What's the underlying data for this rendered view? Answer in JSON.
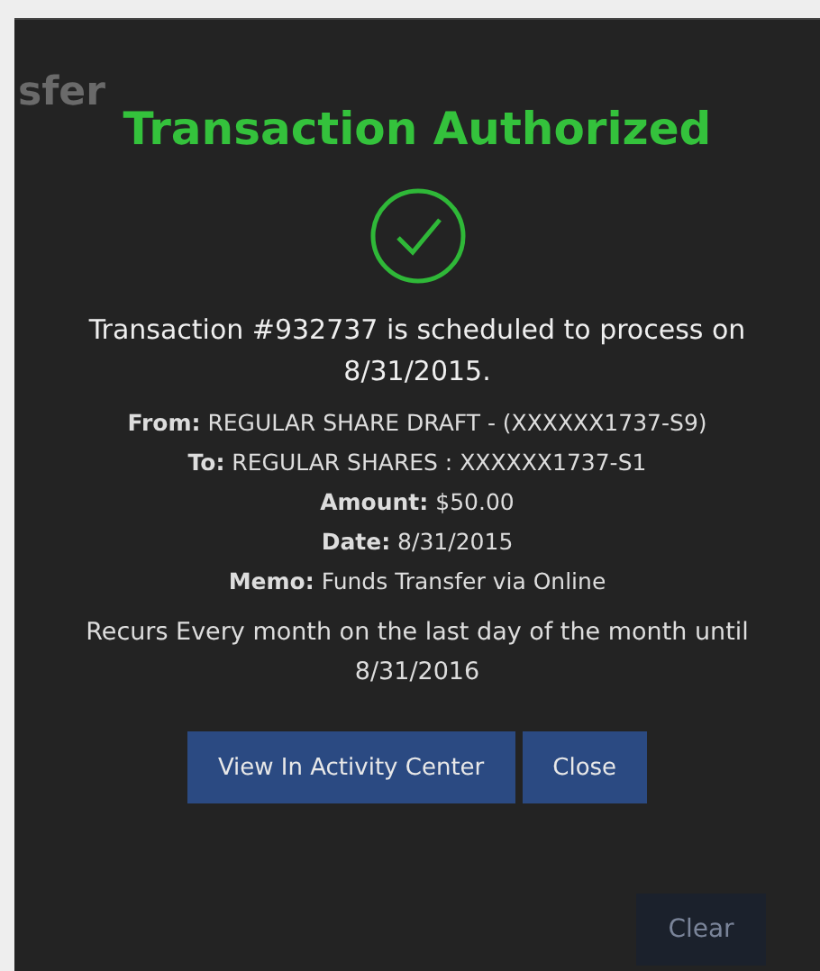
{
  "background": {
    "heading": "sfer",
    "clear_button": "Clear"
  },
  "dialog": {
    "title": "Transaction Authorized",
    "message": "Transaction #932737 is scheduled to process on 8/31/2015.",
    "details": [
      "**From:** REGULAR SHARE DRAFT - (XXXXXX1737-S9)",
      "**To:** REGULAR SHARES : XXXXXX1737-S1",
      "**Amount:** $50.00",
      "**Date:** 8/31/2015",
      "**Memo:** Funds Transfer via Online"
    ],
    "recurrence": "Recurs Every month on the last day of the month until 8/31/2016",
    "buttons": [
      "View In Activity Center",
      "Close"
    ]
  }
}
